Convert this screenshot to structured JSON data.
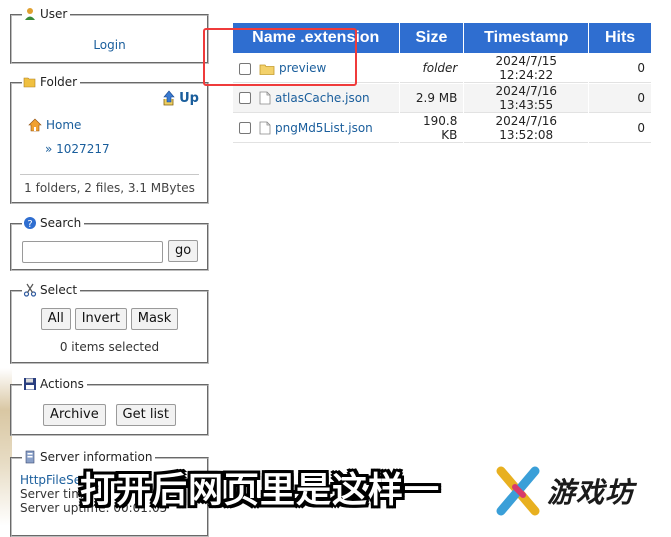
{
  "user_panel": {
    "title": "User",
    "login": "Login"
  },
  "folder_panel": {
    "title": "Folder",
    "up": "Up",
    "home": "Home",
    "current": "» 1027217",
    "summary": "1 folders, 2 files, 3.1 MBytes"
  },
  "search_panel": {
    "title": "Search",
    "input_value": "",
    "go": "go"
  },
  "select_panel": {
    "title": "Select",
    "buttons": [
      "All",
      "Invert",
      "Mask"
    ],
    "status": "0 items selected"
  },
  "actions_panel": {
    "title": "Actions",
    "buttons": [
      "Archive",
      "Get list"
    ]
  },
  "server_panel": {
    "title": "Server information",
    "name": "HttpFileSer",
    "time": "Server time",
    "uptime": "Server uptime: 00:01:05"
  },
  "table": {
    "headers": [
      "Name .extension",
      "Size",
      "Timestamp",
      "Hits"
    ],
    "rows": [
      {
        "name": "preview",
        "size": "folder",
        "timestamp": "2024/7/15 12:24:22",
        "hits": "0",
        "type": "folder"
      },
      {
        "name": "atlasCache.json",
        "size": "2.9 MB",
        "timestamp": "2024/7/16 13:43:55",
        "hits": "0",
        "type": "file"
      },
      {
        "name": "pngMd5List.json",
        "size": "190.8 KB",
        "timestamp": "2024/7/16 13:52:08",
        "hits": "0",
        "type": "file"
      }
    ]
  },
  "caption": "打开后网页里是这样一",
  "watermark": "游戏坊",
  "colors": {
    "header_blue": "#2f6ed0",
    "link": "#1a5e9c",
    "highlight": "#ef3b3b"
  }
}
